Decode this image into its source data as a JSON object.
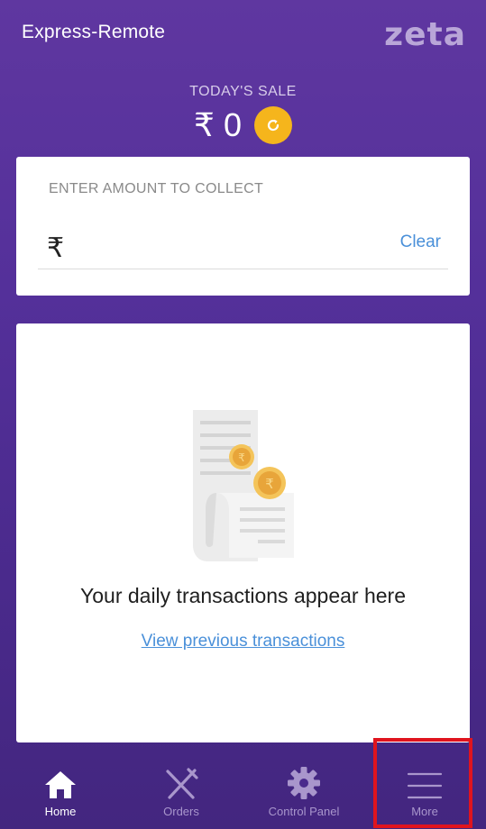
{
  "header": {
    "app_title": "Express-Remote",
    "brand": "zeta"
  },
  "sale": {
    "label": "TODAY'S SALE",
    "value": "₹ 0"
  },
  "collect": {
    "label": "ENTER AMOUNT TO COLLECT",
    "currency_symbol": "₹",
    "amount_value": "",
    "clear_label": "Clear"
  },
  "transactions": {
    "empty_title": "Your daily transactions appear here",
    "view_link": "View previous transactions"
  },
  "nav": {
    "items": [
      {
        "label": "Home",
        "icon": "home-icon",
        "active": true
      },
      {
        "label": "Orders",
        "icon": "fork-knife-icon",
        "active": false
      },
      {
        "label": "Control Panel",
        "icon": "gear-icon",
        "active": false
      },
      {
        "label": "More",
        "icon": "hamburger-menu-icon",
        "active": false
      }
    ]
  },
  "colors": {
    "background": "#54309a",
    "accent_link": "#4a90d9",
    "refresh_button": "#f5b51c",
    "highlight": "#e0141e"
  }
}
